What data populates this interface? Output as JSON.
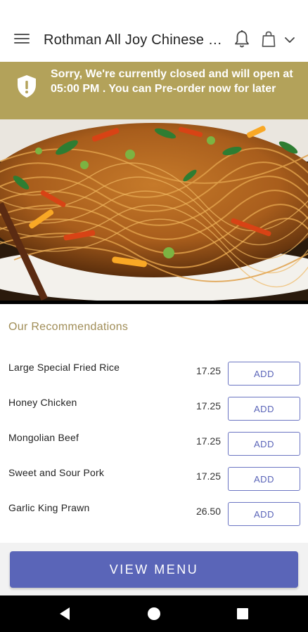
{
  "app_bar": {
    "title": "Rothman All Joy Chinese Restaurant",
    "menu_icon": "hamburger-menu-icon",
    "notification_icon": "bell-icon",
    "cart_icon": "shopping-bag-icon",
    "dropdown_icon": "chevron-down-icon"
  },
  "banner": {
    "icon": "shield-alert-icon",
    "message": "Sorry, We're currently closed and will open at 05:00 PM . You can Pre-order now for later",
    "background": "#b3a25a"
  },
  "hero": {
    "image": "noodles-dish-photo"
  },
  "recommendations": {
    "title": "Our Recommendations",
    "items": [
      {
        "name": "Large Special Fried Rice",
        "price": "17.25",
        "button": "ADD"
      },
      {
        "name": "Honey Chicken",
        "price": "17.25",
        "button": "ADD"
      },
      {
        "name": "Mongolian Beef",
        "price": "17.25",
        "button": "ADD"
      },
      {
        "name": "Sweet and Sour Pork",
        "price": "17.25",
        "button": "ADD"
      },
      {
        "name": "Garlic King Prawn",
        "price": "26.50",
        "button": "ADD"
      }
    ]
  },
  "footer": {
    "view_menu_label": "VIEW MENU",
    "accent": "#5a65b8"
  },
  "nav": {
    "back_icon": "back-triangle-icon",
    "home_icon": "home-circle-icon",
    "recents_icon": "recents-square-icon"
  }
}
